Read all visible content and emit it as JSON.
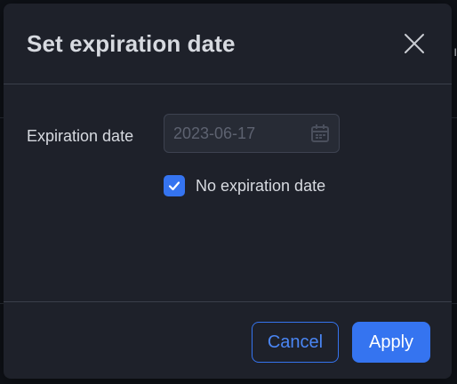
{
  "dialog": {
    "title": "Set expiration date",
    "close_icon": "close-icon"
  },
  "form": {
    "expiration_label": "Expiration date",
    "date_value": "2023-06-17",
    "date_disabled": true,
    "calendar_icon": "calendar-icon",
    "no_expiration_checked": true,
    "no_expiration_label": "No expiration date"
  },
  "footer": {
    "cancel_label": "Cancel",
    "apply_label": "Apply"
  },
  "colors": {
    "accent": "#3574f0",
    "dialog_bg": "#1e212a",
    "text": "#d7dae0"
  }
}
